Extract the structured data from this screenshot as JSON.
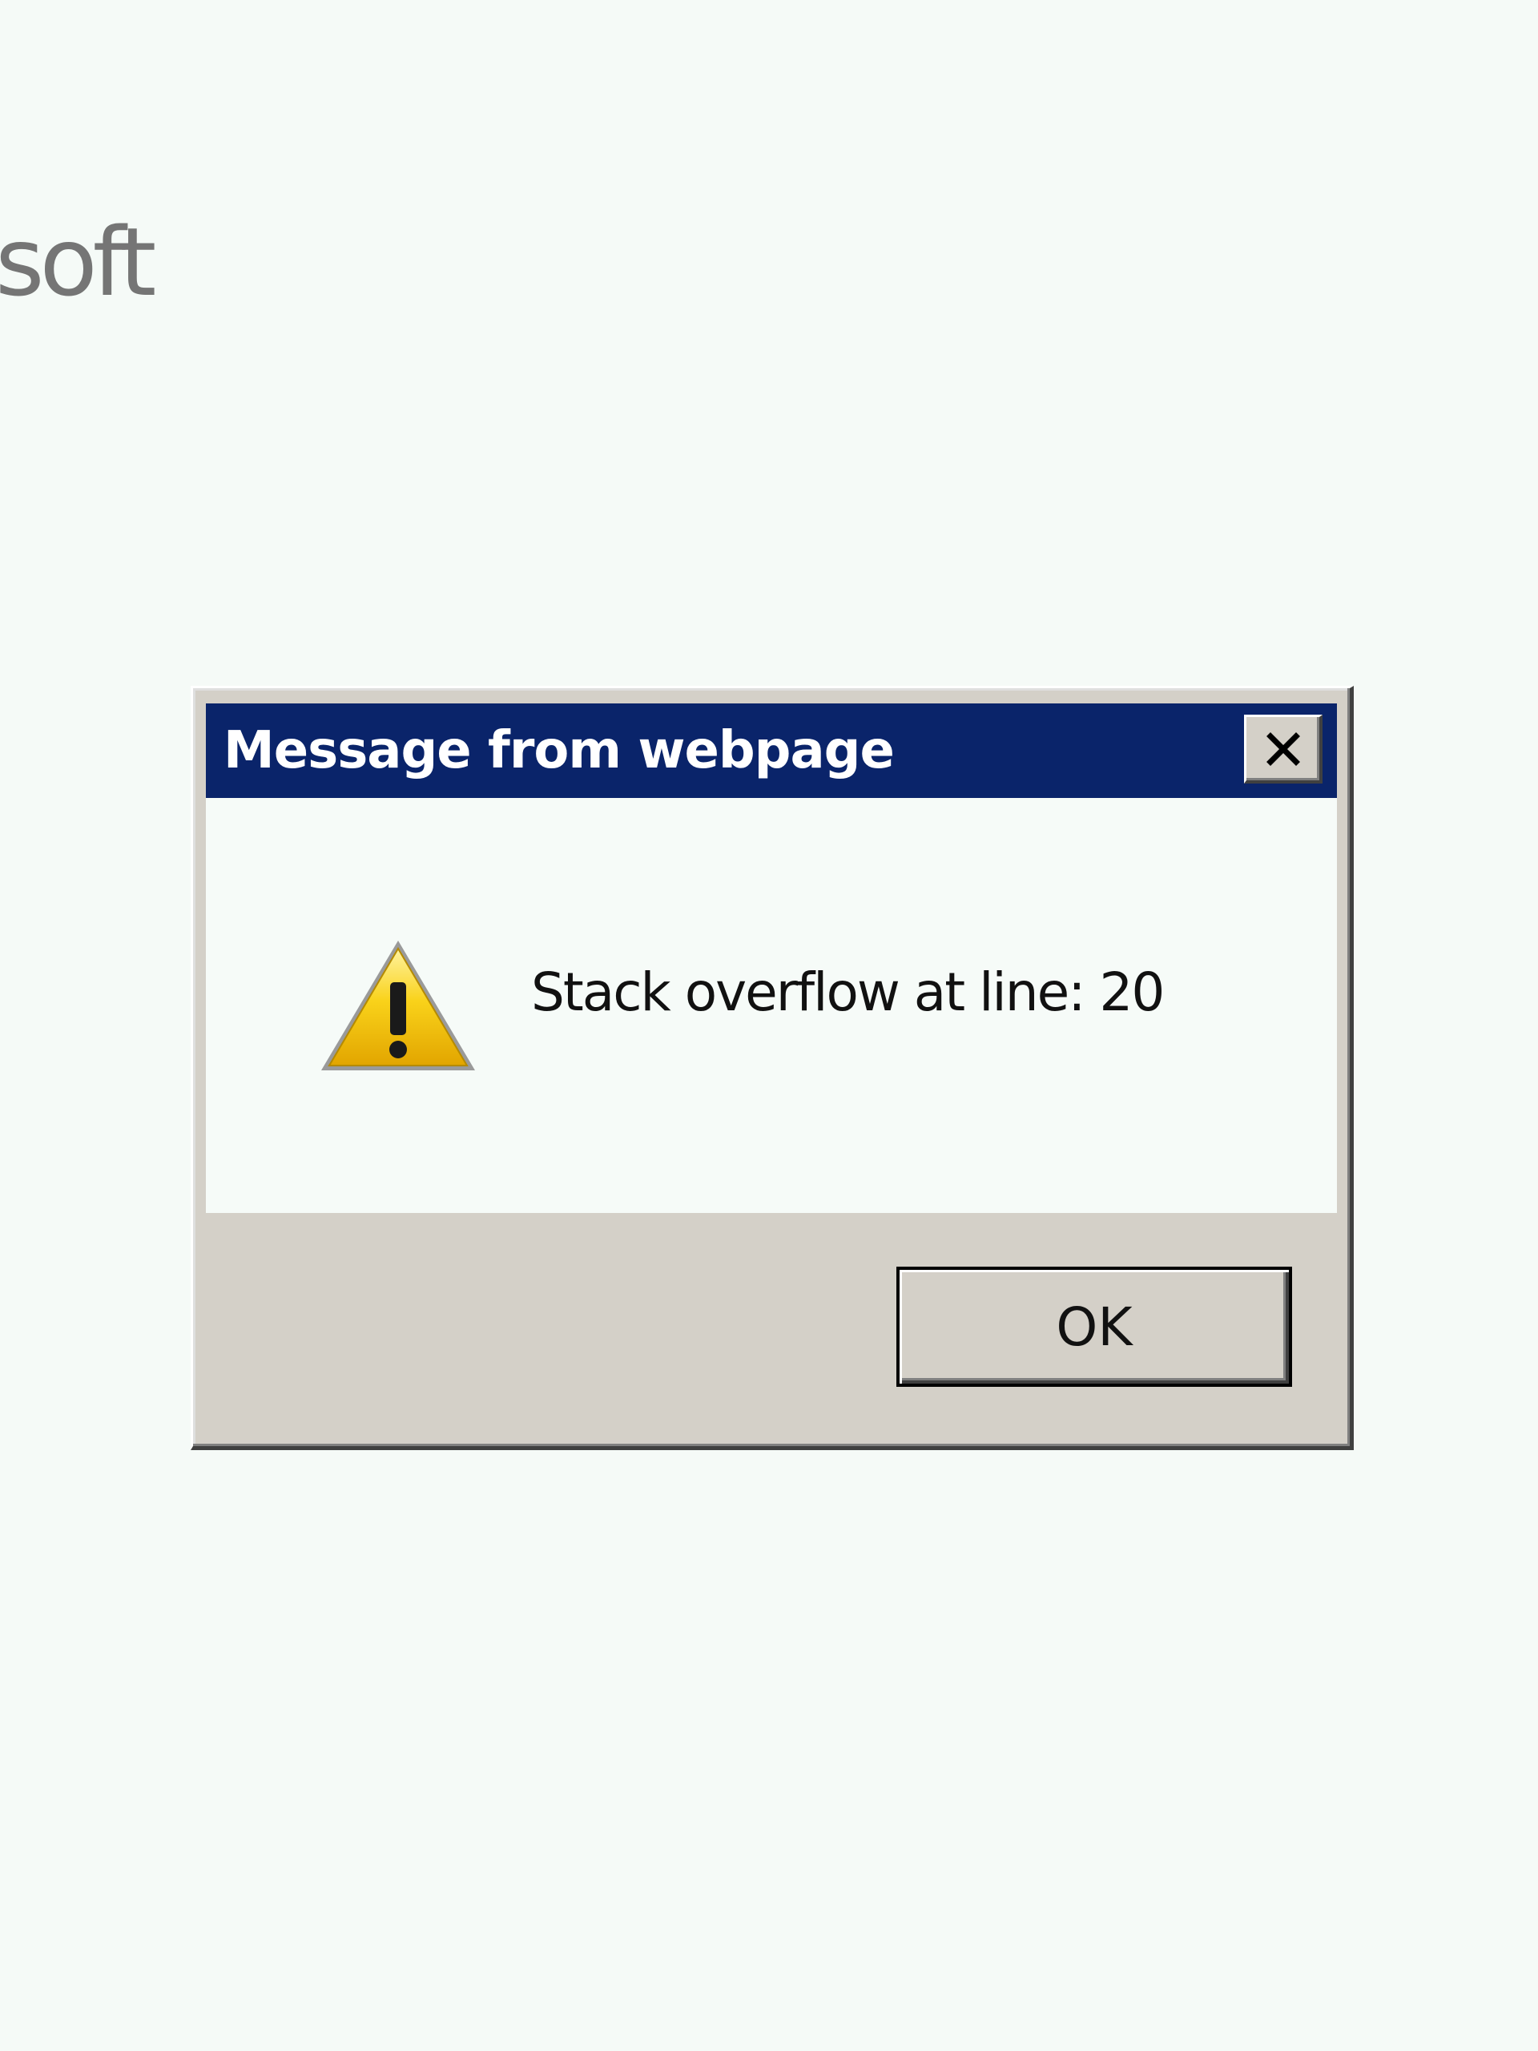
{
  "background": {
    "text_fragment": "soft"
  },
  "dialog": {
    "title": "Message from webpage",
    "close_icon": "close-icon",
    "message": "Stack overflow at line: 20",
    "warning_icon": "warning-icon",
    "ok_label": "OK"
  },
  "colors": {
    "titlebar": "#0a246a",
    "dialog_face": "#d4d0c8",
    "content_background": "#f6fbf8",
    "page_background": "#f5faf7",
    "warning_yellow": "#f5c400"
  }
}
